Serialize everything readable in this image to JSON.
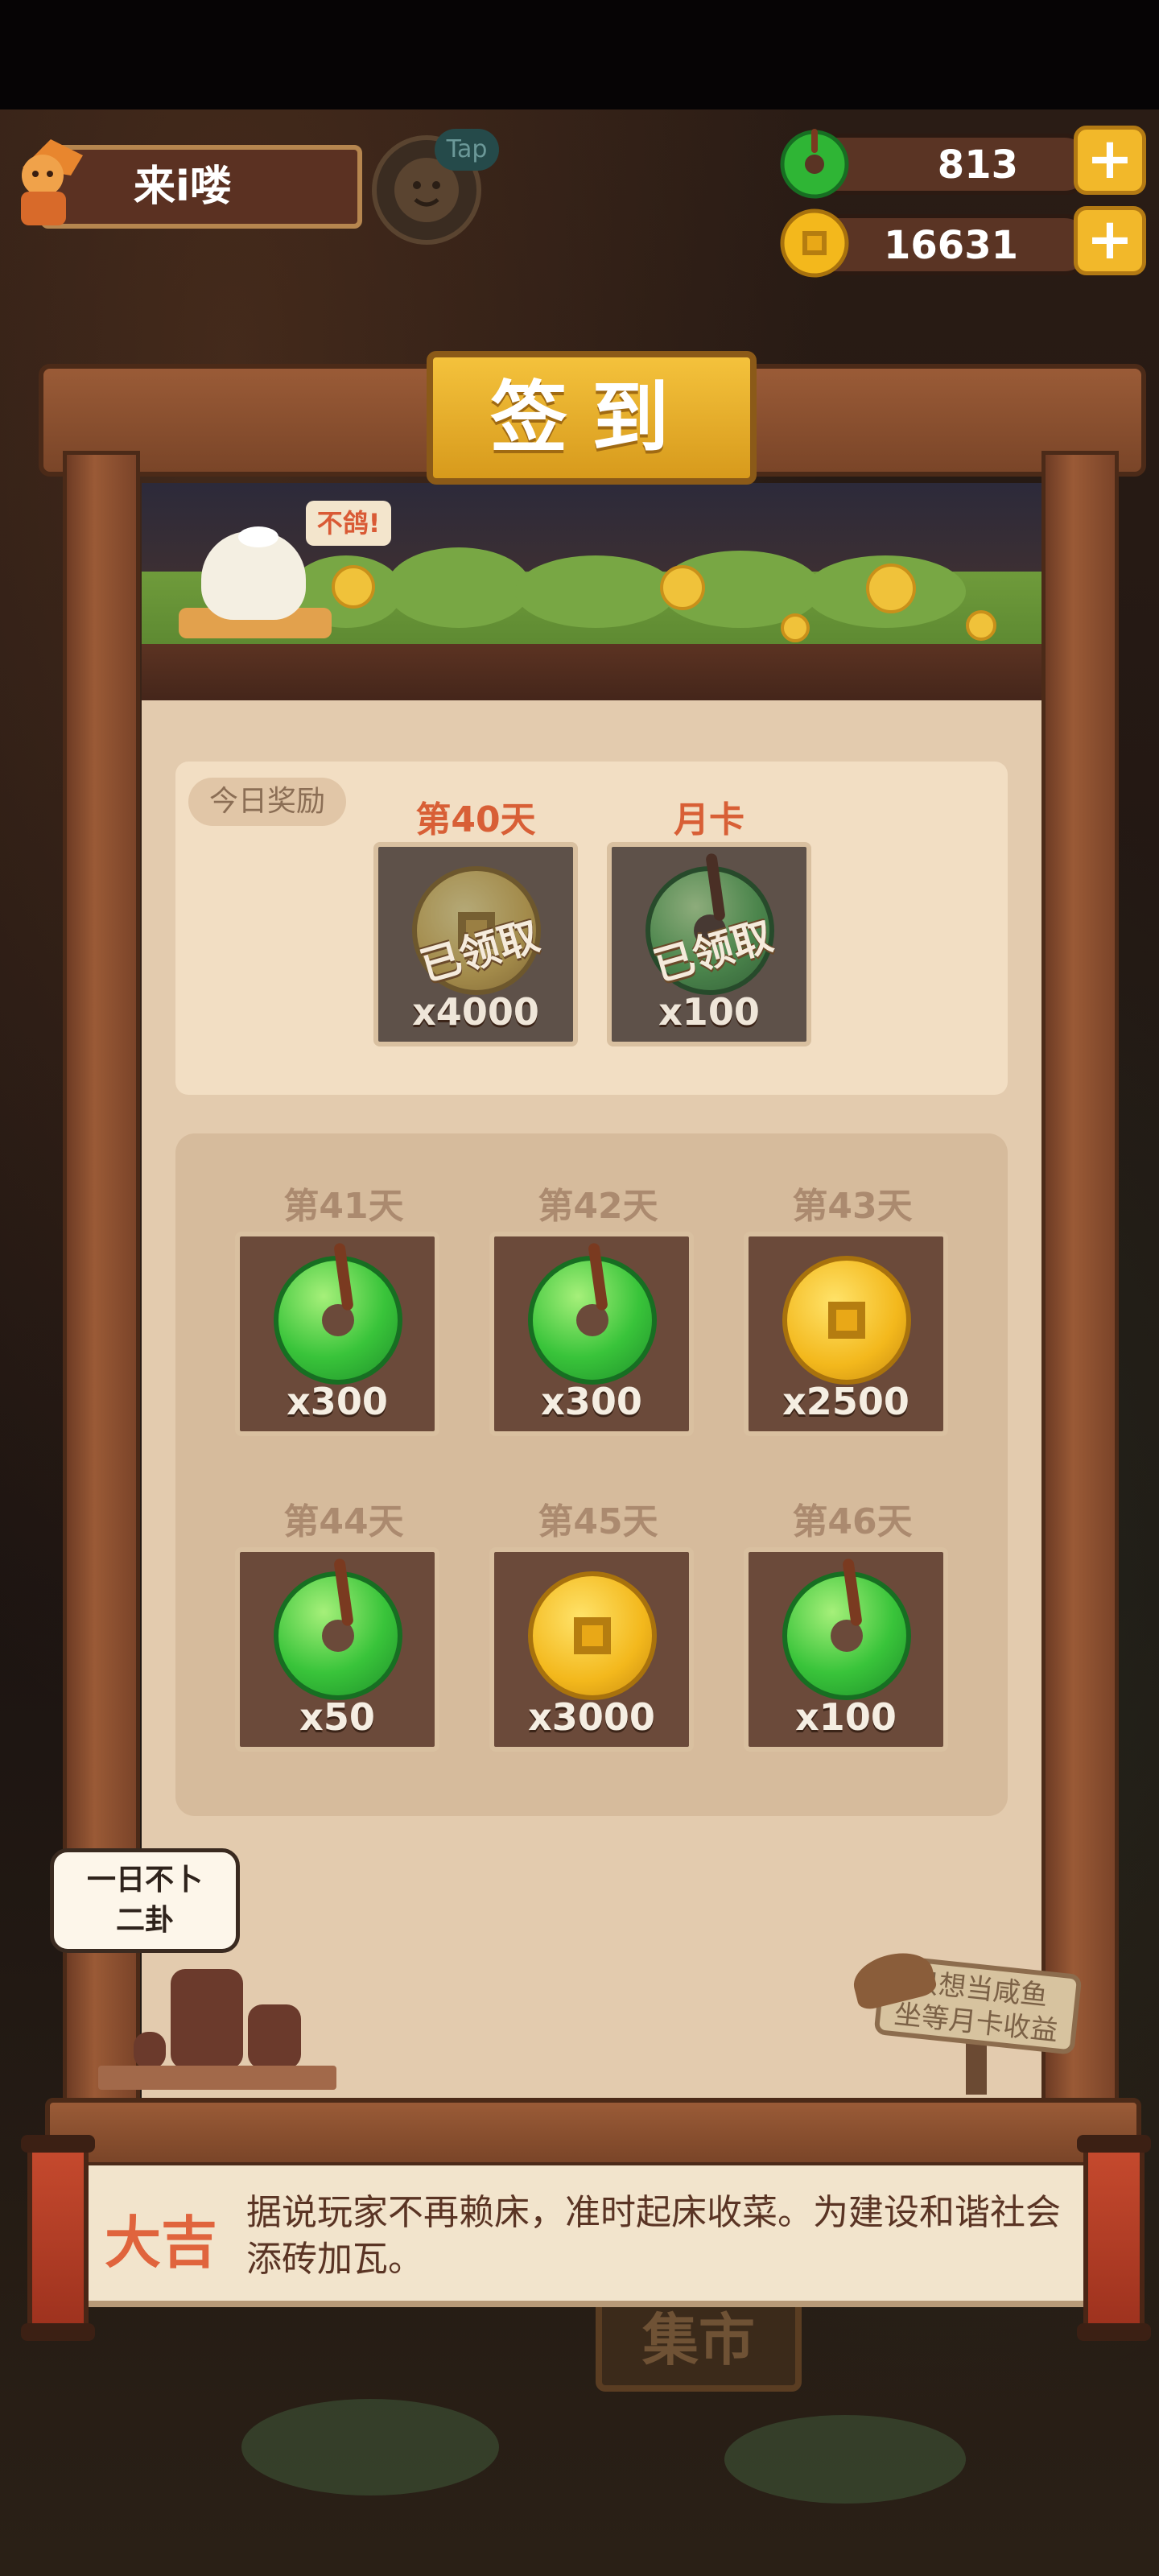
{
  "player": {
    "name": "来i喽",
    "tap_label": "Tap"
  },
  "resources": [
    {
      "type": "jade",
      "value": "813"
    },
    {
      "type": "coin",
      "value": "16631"
    }
  ],
  "board": {
    "title": "签到",
    "chicken_speech": "不鸽!",
    "today": {
      "tag": "今日奖励",
      "items": [
        {
          "title": "第40天",
          "reward": "coin",
          "qty": "x4000",
          "status": "已领取"
        },
        {
          "title": "月卡",
          "reward": "jade",
          "qty": "x100",
          "status": "已领取"
        }
      ]
    },
    "upcoming": [
      {
        "day": "第41天",
        "reward": "jade",
        "qty": "x300"
      },
      {
        "day": "第42天",
        "reward": "jade",
        "qty": "x300"
      },
      {
        "day": "第43天",
        "reward": "coin",
        "qty": "x2500"
      },
      {
        "day": "第44天",
        "reward": "jade",
        "qty": "x50"
      },
      {
        "day": "第45天",
        "reward": "coin",
        "qty": "x3000"
      },
      {
        "day": "第46天",
        "reward": "jade",
        "qty": "x100"
      }
    ]
  },
  "speech_left": {
    "line1": "一日不卜",
    "line2": "二卦"
  },
  "sign_right": {
    "line1": "只想当咸鱼",
    "line2": "坐等月卡收益"
  },
  "fortune": {
    "label": "大吉",
    "text": "据说玩家不再赖床，准时起床收菜。为建设和谐社会添砖加瓦。"
  },
  "background": {
    "market_sign": "集市"
  },
  "colors": {
    "gold": "#f2b82a",
    "jade": "#39c43a",
    "wood": "#7a4528",
    "fortune_red": "#e0643d"
  }
}
